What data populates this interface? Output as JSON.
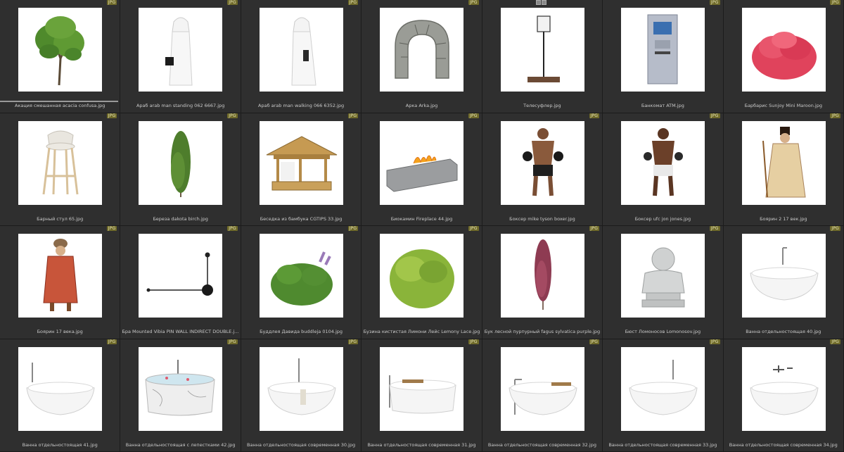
{
  "badge_label": "JPG",
  "accent_badge_bg": "#6f6a2a",
  "items": [
    {
      "caption": "Акация смешанная acacia confusa.jpg",
      "icon": "tree-icon",
      "badge": "JPG",
      "progress": 1.0
    },
    {
      "caption": "Араб arab man standing 062 6667.jpg",
      "icon": "man-standing-icon",
      "badge": "JPG"
    },
    {
      "caption": "Араб arab man walking 066 6352.jpg",
      "icon": "man-walking-icon",
      "badge": "JPG"
    },
    {
      "caption": "Арка Arka.jpg",
      "icon": "stone-arch-icon",
      "badge": "JPG"
    },
    {
      "caption": "Телесуфлер.jpg",
      "icon": "teleprompter-icon",
      "badge": ""
    },
    {
      "caption": "Банкомат ATM.jpg",
      "icon": "atm-icon",
      "badge": "JPG"
    },
    {
      "caption": "Барбарис Sunjoy Mini Maroon.jpg",
      "icon": "red-shrub-icon",
      "badge": "JPG"
    },
    {
      "caption": "Барный стул 65.jpg",
      "icon": "bar-stool-icon",
      "badge": "JPG"
    },
    {
      "caption": "Береза dakota birch.jpg",
      "icon": "birch-tree-icon",
      "badge": "JPG"
    },
    {
      "caption": "Беседка из бамбука CGTIPS 33.jpg",
      "icon": "gazebo-icon",
      "badge": "JPG"
    },
    {
      "caption": "Биокамин Fireplace 44.jpg",
      "icon": "fireplace-icon",
      "badge": "JPG"
    },
    {
      "caption": "Боксер mike tyson boxer.jpg",
      "icon": "boxer-icon",
      "badge": "JPG"
    },
    {
      "caption": "Боксер ufc jon jones.jpg",
      "icon": "boxer-icon",
      "badge": "JPG"
    },
    {
      "caption": "Боярин 2 17 век.jpg",
      "icon": "boyar-icon",
      "badge": "JPG"
    },
    {
      "caption": "Боярин 17 века.jpg",
      "icon": "boyar-icon",
      "badge": "JPG"
    },
    {
      "caption": "Бра Mounted Vibia PIN WALL INDIRECT DOUBLE.jpg",
      "icon": "wall-lamp-icon",
      "badge": "JPG"
    },
    {
      "caption": "Буддлея Давида buddleja 0104.jpg",
      "icon": "flower-bush-icon",
      "badge": "JPG"
    },
    {
      "caption": "Бузина кистистая Лимони Лейс Lemony Lace.jpg",
      "icon": "yellow-bush-icon",
      "badge": "JPG"
    },
    {
      "caption": "Бук лесной пурпурный fagus sylvatica purple.jpg",
      "icon": "purple-tree-icon",
      "badge": "JPG"
    },
    {
      "caption": "Бюст Ломоносов Lomonosov.jpg",
      "icon": "bust-icon",
      "badge": "JPG"
    },
    {
      "caption": "Ванна отдельностоящая 40.jpg",
      "icon": "bathtub-icon",
      "badge": "JPG"
    },
    {
      "caption": "Ванна отдельностоящая 41.jpg",
      "icon": "bathtub-icon",
      "badge": "JPG"
    },
    {
      "caption": "Ванна отдельностоящая с лепестками 42.jpg",
      "icon": "marble-bathtub-icon",
      "badge": "JPG"
    },
    {
      "caption": "Ванна отдельностоящая современная 30.jpg",
      "icon": "bathtub-icon",
      "badge": "JPG"
    },
    {
      "caption": "Ванна отдельностоящая современная 31.jpg",
      "icon": "bathtub-icon",
      "badge": "JPG"
    },
    {
      "caption": "Ванна отдельностоящая современная 32.jpg",
      "icon": "bathtub-icon",
      "badge": "JPG"
    },
    {
      "caption": "Ванна отдельностоящая современная 33.jpg",
      "icon": "bathtub-icon",
      "badge": "JPG"
    },
    {
      "caption": "Ванна отдельностоящая современная 34.jpg",
      "icon": "bathtub-icon",
      "badge": "JPG"
    }
  ]
}
